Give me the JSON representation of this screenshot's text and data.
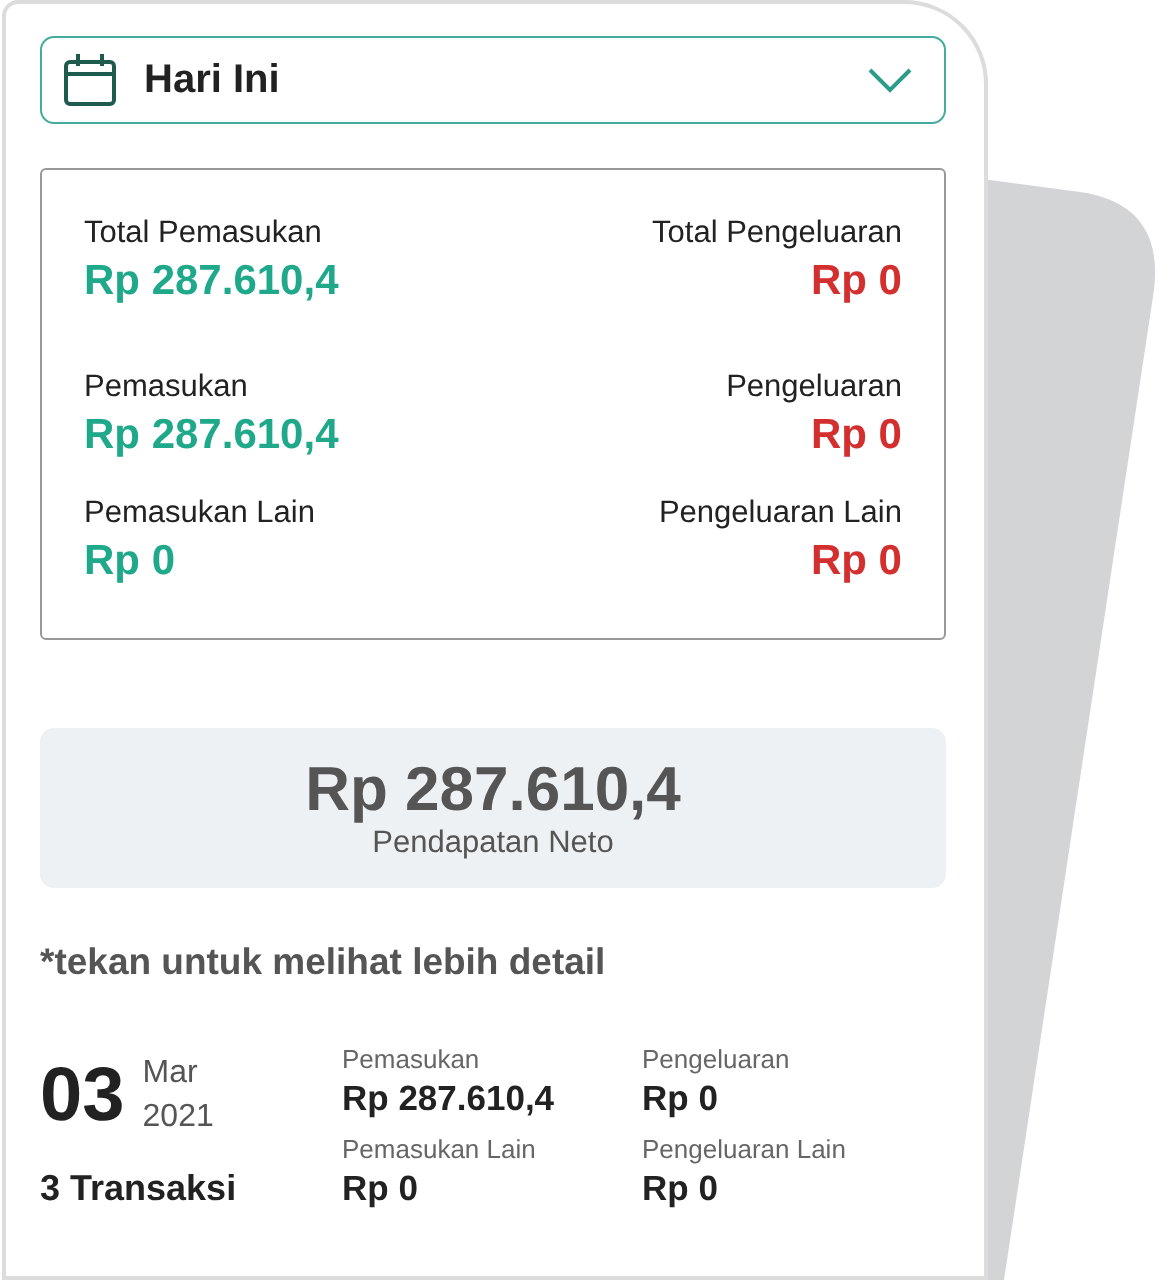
{
  "date_filter": {
    "label": "Hari Ini"
  },
  "summary": [
    {
      "left": {
        "label": "Total Pemasukan",
        "value": "Rp 287.610,4",
        "kind": "income"
      },
      "right": {
        "label": "Total Pengeluaran",
        "value": "Rp 0",
        "kind": "expense"
      }
    },
    {
      "left": {
        "label": "Pemasukan",
        "value": "Rp 287.610,4",
        "kind": "income"
      },
      "right": {
        "label": "Pengeluaran",
        "value": "Rp 0",
        "kind": "expense"
      }
    },
    {
      "left": {
        "label": "Pemasukan Lain",
        "value": "Rp 0",
        "kind": "income"
      },
      "right": {
        "label": "Pengeluaran Lain",
        "value": "Rp 0",
        "kind": "expense"
      }
    }
  ],
  "net": {
    "amount": "Rp 287.610,4",
    "label": "Pendapatan Neto"
  },
  "hint": "*tekan untuk melihat lebih detail",
  "transactions": [
    {
      "day": "03",
      "month": "Mar",
      "year": "2021",
      "count": "3 Transaksi",
      "items": [
        {
          "label": "Pemasukan",
          "value": "Rp 287.610,4"
        },
        {
          "label": "Pengeluaran",
          "value": "Rp 0"
        },
        {
          "label": "Pemasukan Lain",
          "value": "Rp 0"
        },
        {
          "label": "Pengeluaran Lain",
          "value": "Rp 0"
        }
      ]
    }
  ]
}
